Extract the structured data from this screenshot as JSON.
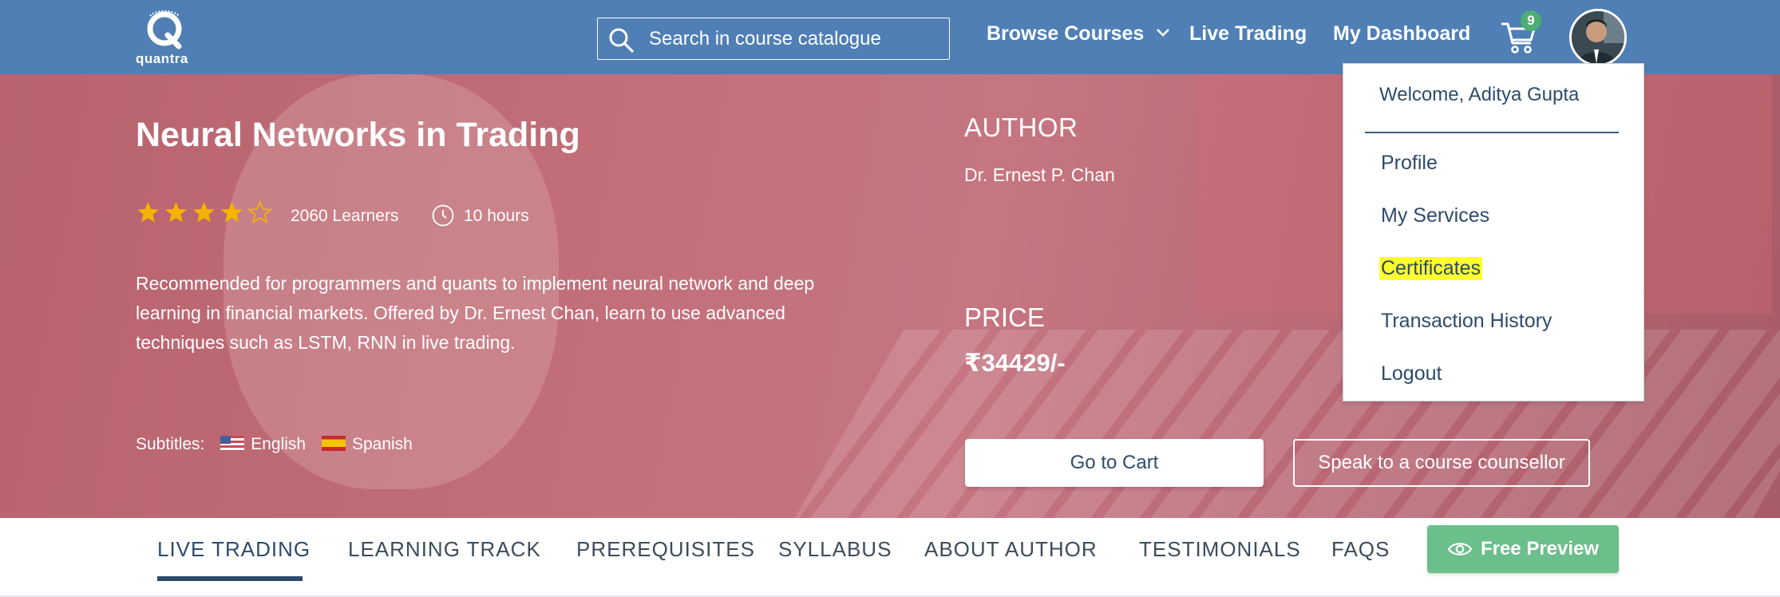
{
  "header": {
    "logo_text": "quantra",
    "search_placeholder": "Search in course catalogue",
    "nav": {
      "browse_courses": "Browse Courses",
      "live_trading": "Live Trading",
      "my_dashboard": "My Dashboard"
    },
    "cart_count": "9"
  },
  "course": {
    "title": "Neural Networks in Trading",
    "rating": 4,
    "rating_max": 5,
    "learners": "2060 Learners",
    "duration": "10 hours",
    "description": "Recommended for programmers and quants to implement neural network and deep learning in financial markets. Offered by Dr. Ernest Chan, learn to use advanced techniques such as LSTM, RNN in live trading.",
    "subtitles_label": "Subtitles:",
    "subtitles": [
      "English",
      "Spanish"
    ],
    "author_heading": "AUTHOR",
    "author_name": "Dr. Ernest P. Chan",
    "price_heading": "PRICE",
    "price": "₹34429/-",
    "go_to_cart": "Go to Cart",
    "speak_counsellor": "Speak to a course counsellor"
  },
  "user_menu": {
    "welcome": "Welcome, Aditya Gupta",
    "items": [
      "Profile",
      "My Services",
      "Certificates",
      "Transaction History",
      "Logout"
    ],
    "highlighted": "Certificates",
    "highlight_color": "#ffff2e"
  },
  "tabs": {
    "items": [
      "LIVE TRADING",
      "LEARNING TRACK",
      "PREREQUISITES",
      "SYLLABUS",
      "ABOUT AUTHOR",
      "TESTIMONIALS",
      "FAQS"
    ],
    "active": "LIVE TRADING",
    "free_preview": "Free Preview"
  },
  "colors": {
    "header_bg": "#4f7fb5",
    "hero_tint": "#c26f7a",
    "star": "#f5b300",
    "badge": "#4cae71",
    "preview_button": "#6bbf8a",
    "text_dark": "#2d4b6b"
  },
  "icons": {
    "search": "search-icon",
    "chevron": "chevron-down-icon",
    "cart": "cart-icon",
    "clock": "clock-icon",
    "eye": "eye-icon"
  }
}
